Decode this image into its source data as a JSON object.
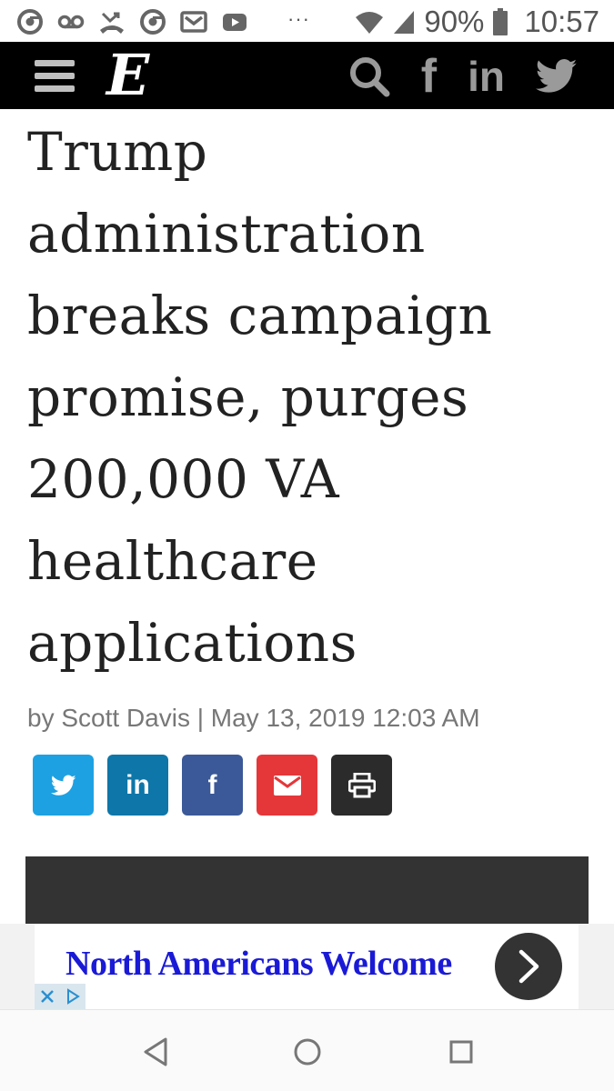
{
  "status_bar": {
    "battery_percent": "90%",
    "time": "10:57",
    "more_indicator": "···",
    "icons": [
      "chrome-icon",
      "voicemail-icon",
      "missed-call-icon",
      "chrome-icon",
      "gmail-icon",
      "youtube-icon",
      "wifi-icon",
      "signal-icon",
      "battery-icon"
    ]
  },
  "site_header": {
    "logo": "E",
    "icons": [
      "menu-icon",
      "search-icon",
      "facebook-icon",
      "linkedin-icon",
      "twitter-icon"
    ],
    "facebook_label": "f",
    "linkedin_label": "in"
  },
  "article": {
    "headline": "Trump administration breaks campaign promise, purges 200,000 VA healthcare applications",
    "byline": "by Scott Davis | May 13, 2019 12:03 AM"
  },
  "share_buttons": [
    {
      "icon": "twitter-icon",
      "color": "#1da1e2"
    },
    {
      "icon": "linkedin-icon",
      "label": "in",
      "color": "#0e76a8"
    },
    {
      "icon": "facebook-icon",
      "label": "f",
      "color": "#3b5998"
    },
    {
      "icon": "email-icon",
      "color": "#e5373a"
    },
    {
      "icon": "print-icon",
      "color": "#2b2b2b"
    }
  ],
  "ad": {
    "text": "North Americans Welcome",
    "text_color": "#1a1ad6",
    "icons": [
      "chevron-right-icon",
      "close-icon",
      "adchoices-icon"
    ]
  },
  "nav_bar": {
    "icons": [
      "back-icon",
      "home-icon",
      "recents-icon"
    ]
  },
  "colors": {
    "header_bg": "#000000",
    "headline": "#222222",
    "byline": "#777777"
  }
}
